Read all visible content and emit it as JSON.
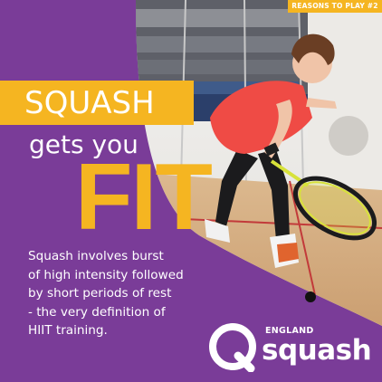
{
  "badge": "REASONS TO PLAY #2",
  "headline": {
    "line1": "SQUASH",
    "line2": "gets you",
    "line3": "FIT"
  },
  "body_lines": [
    "Squash involves burst",
    "of high intensity followed",
    "by short periods of rest",
    "- the very definition of",
    "HIIT training."
  ],
  "logo": {
    "line1": "ENGLAND",
    "line2": "squash",
    "icon": "england-squash-q-mark"
  },
  "colors": {
    "purple": "#7a3c98",
    "yellow": "#f5b521",
    "text": "#ffffff"
  },
  "photo_icon": "squash-player-lunging-photo"
}
